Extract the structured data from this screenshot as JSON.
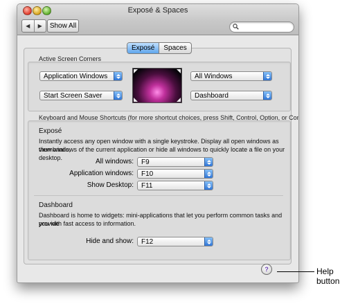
{
  "window": {
    "title": "Exposé & Spaces"
  },
  "toolbar": {
    "back_icon": "◀",
    "forward_icon": "▶",
    "show_all_label": "Show All",
    "search_value": ""
  },
  "tabs": [
    {
      "label": "Exposé",
      "selected": true
    },
    {
      "label": "Spaces",
      "selected": false
    }
  ],
  "corners": {
    "section_label": "Active Screen Corners",
    "top_left": "Application Windows",
    "bottom_left": "Start Screen Saver",
    "top_right": "All Windows",
    "bottom_right": "Dashboard"
  },
  "shortcuts": {
    "section_label": "Keyboard and Mouse Shortcuts (for more shortcut choices, press Shift, Control, Option, or Command)",
    "expose": {
      "title": "Exposé",
      "description_line1": "Instantly access any open window with a single keystroke. Display all open windows as thumbnails,",
      "description_line2": "view windows of the current application or hide all windows to quickly locate a file on your desktop.",
      "rows": [
        {
          "label": "All windows:",
          "value": "F9"
        },
        {
          "label": "Application windows:",
          "value": "F10"
        },
        {
          "label": "Show Desktop:",
          "value": "F11"
        }
      ]
    },
    "dashboard": {
      "title": "Dashboard",
      "description_line1": "Dashboard is home to widgets: mini-applications that let you perform common tasks and provide",
      "description_line2": "you with fast access to information.",
      "row": {
        "label": "Hide and show:",
        "value": "F12"
      }
    }
  },
  "help": {
    "glyph": "?",
    "annotation": "Help button"
  },
  "colors": {
    "accent": "#3b82e0",
    "window_bg": "#e8e8e8"
  }
}
